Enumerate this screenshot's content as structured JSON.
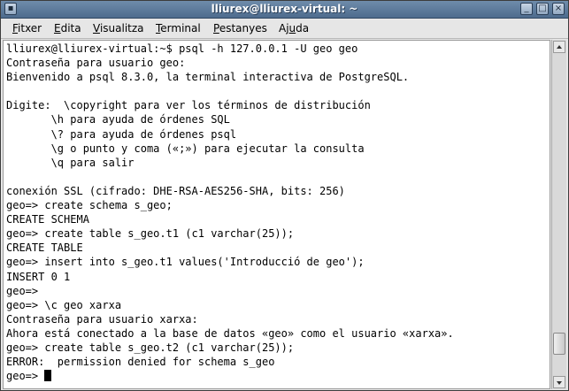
{
  "window": {
    "title": "lliurex@lliurex-virtual: ~"
  },
  "menu": [
    {
      "pre": "",
      "acc": "F",
      "post": "itxer"
    },
    {
      "pre": "",
      "acc": "E",
      "post": "dita"
    },
    {
      "pre": "",
      "acc": "V",
      "post": "isualitza"
    },
    {
      "pre": "",
      "acc": "T",
      "post": "erminal"
    },
    {
      "pre": "",
      "acc": "P",
      "post": "estanyes"
    },
    {
      "pre": "Aj",
      "acc": "u",
      "post": "da"
    }
  ],
  "terminal": {
    "lines": [
      "lliurex@lliurex-virtual:~$ psql -h 127.0.0.1 -U geo geo",
      "Contraseña para usuario geo:",
      "Bienvenido a psql 8.3.0, la terminal interactiva de PostgreSQL.",
      "",
      "Digite:  \\copyright para ver los términos de distribución",
      "       \\h para ayuda de órdenes SQL",
      "       \\? para ayuda de órdenes psql",
      "       \\g o punto y coma («;») para ejecutar la consulta",
      "       \\q para salir",
      "",
      "conexión SSL (cifrado: DHE-RSA-AES256-SHA, bits: 256)",
      "geo=> create schema s_geo;",
      "CREATE SCHEMA",
      "geo=> create table s_geo.t1 (c1 varchar(25));",
      "CREATE TABLE",
      "geo=> insert into s_geo.t1 values('Introducció de geo');",
      "INSERT 0 1",
      "geo=>",
      "geo=> \\c geo xarxa",
      "Contraseña para usuario xarxa:",
      "Ahora está conectado a la base de datos «geo» como el usuario «xarxa».",
      "geo=> create table s_geo.t2 (c1 varchar(25));",
      "ERROR:  permission denied for schema s_geo"
    ],
    "prompt": "geo=> "
  },
  "scrollbar": {
    "position": 0.93,
    "visible_fraction": 0.07
  }
}
